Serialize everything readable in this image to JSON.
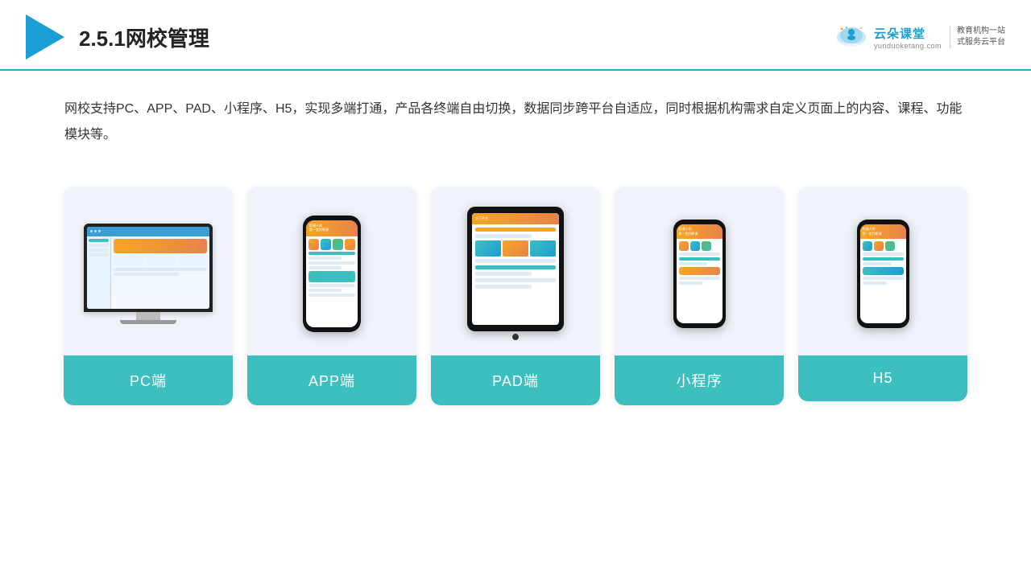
{
  "header": {
    "title": "2.5.1网校管理",
    "brand": {
      "name": "云朵课堂",
      "url": "yunduoketang.com",
      "slogan": "教育机构一站\n式服务云平台"
    }
  },
  "description": "网校支持PC、APP、PAD、小程序、H5，实现多端打通，产品各终端自由切换，数据同步跨平台自适应，同时根据机构需求自定义页面上的内容、课程、功能模块等。",
  "cards": [
    {
      "label": "PC端",
      "type": "pc"
    },
    {
      "label": "APP端",
      "type": "phone"
    },
    {
      "label": "PAD端",
      "type": "tablet"
    },
    {
      "label": "小程序",
      "type": "phone-mini"
    },
    {
      "label": "H5",
      "type": "phone-mini2"
    }
  ],
  "colors": {
    "accent": "#1ab3c8",
    "card_bg": "#f0f4fa",
    "label_bg": "#3dbfbf",
    "label_text": "#ffffff"
  }
}
